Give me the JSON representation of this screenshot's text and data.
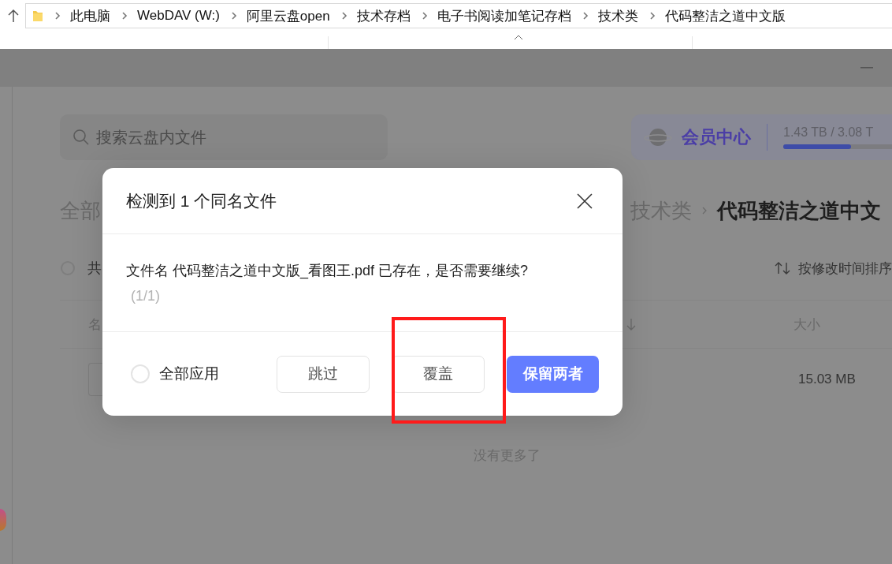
{
  "explorer": {
    "path": [
      "此电脑",
      "WebDAV (W:)",
      "阿里云盘open",
      "技术存档",
      "电子书阅读加笔记存档",
      "技术类",
      "代码整洁之道中文版"
    ]
  },
  "app": {
    "search": {
      "placeholder": "搜索云盘内文件"
    },
    "member": {
      "label": "会员中心",
      "storage": "1.43 TB / 3.08 T",
      "level": 0.46
    },
    "breadcrumb": [
      {
        "label": "全部",
        "current": false
      },
      {
        "label": "技术类",
        "current": false
      },
      {
        "label": "代码整洁之道中文",
        "current": true
      }
    ],
    "select_all": {
      "label": "共",
      "checked": false
    },
    "sort": "按修改时间排序",
    "columns": [
      "名",
      "大小"
    ],
    "rows": [
      {
        "size": "15.03 MB"
      }
    ],
    "end_note": "没有更多了"
  },
  "dialog": {
    "title": "检测到 1 个同名文件",
    "message": "文件名 代码整洁之道中文版_看图王.pdf 已存在，是否需要继续?",
    "counter": "(1/1)",
    "apply_all": {
      "label": "全部应用",
      "checked": false
    },
    "buttons": [
      {
        "label": "跳过",
        "kind": "secondary",
        "highlighted": false
      },
      {
        "label": "覆盖",
        "kind": "secondary",
        "highlighted": true
      },
      {
        "label": "保留两者",
        "kind": "primary",
        "highlighted": false
      }
    ]
  }
}
